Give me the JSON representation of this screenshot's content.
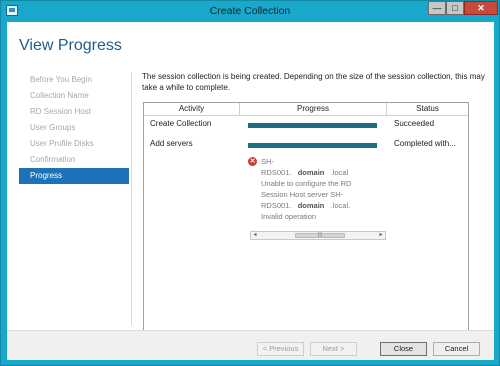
{
  "window": {
    "title": "Create Collection",
    "controls": {
      "minimize": "—",
      "maximize": "□",
      "close": "✕"
    }
  },
  "page": {
    "heading": "View Progress",
    "description": "The session collection is being created. Depending on the size of the session collection, this may take a while to complete."
  },
  "nav": {
    "items": [
      {
        "label": "Before You Begin",
        "active": false
      },
      {
        "label": "Collection Name",
        "active": false
      },
      {
        "label": "RD Session Host",
        "active": false
      },
      {
        "label": "User Groups",
        "active": false
      },
      {
        "label": "User Profile Disks",
        "active": false
      },
      {
        "label": "Confirmation",
        "active": false
      },
      {
        "label": "Progress",
        "active": true
      }
    ]
  },
  "table": {
    "columns": [
      "Activity",
      "Progress",
      "Status"
    ],
    "rows": [
      {
        "activity": "Create Collection",
        "progress": 1.0,
        "status": "Succeeded"
      },
      {
        "activity": "Add servers",
        "progress": 1.0,
        "status": "Completed with..."
      }
    ],
    "error": {
      "line1": "SH-",
      "line2a": "RDS001.",
      "line2b": "domain",
      "line2c": ".local",
      "line3": "Unable to configure the RD",
      "line4": "Session Host server SH-",
      "line5a": "RDS001.",
      "line5b": "domain",
      "line5c": ".local.",
      "line6": "Invalid operation",
      "scroll": {
        "left": "◂",
        "right": "▸",
        "thumb": "|||"
      }
    }
  },
  "footer": {
    "previous": "< Previous",
    "next": "Next >",
    "close": "Close",
    "cancel": "Cancel"
  },
  "colors": {
    "accent": "#1e73b8",
    "progress_bar": "#1a6f84",
    "title_bar": "#19a8c9",
    "error": "#d33a2f"
  }
}
